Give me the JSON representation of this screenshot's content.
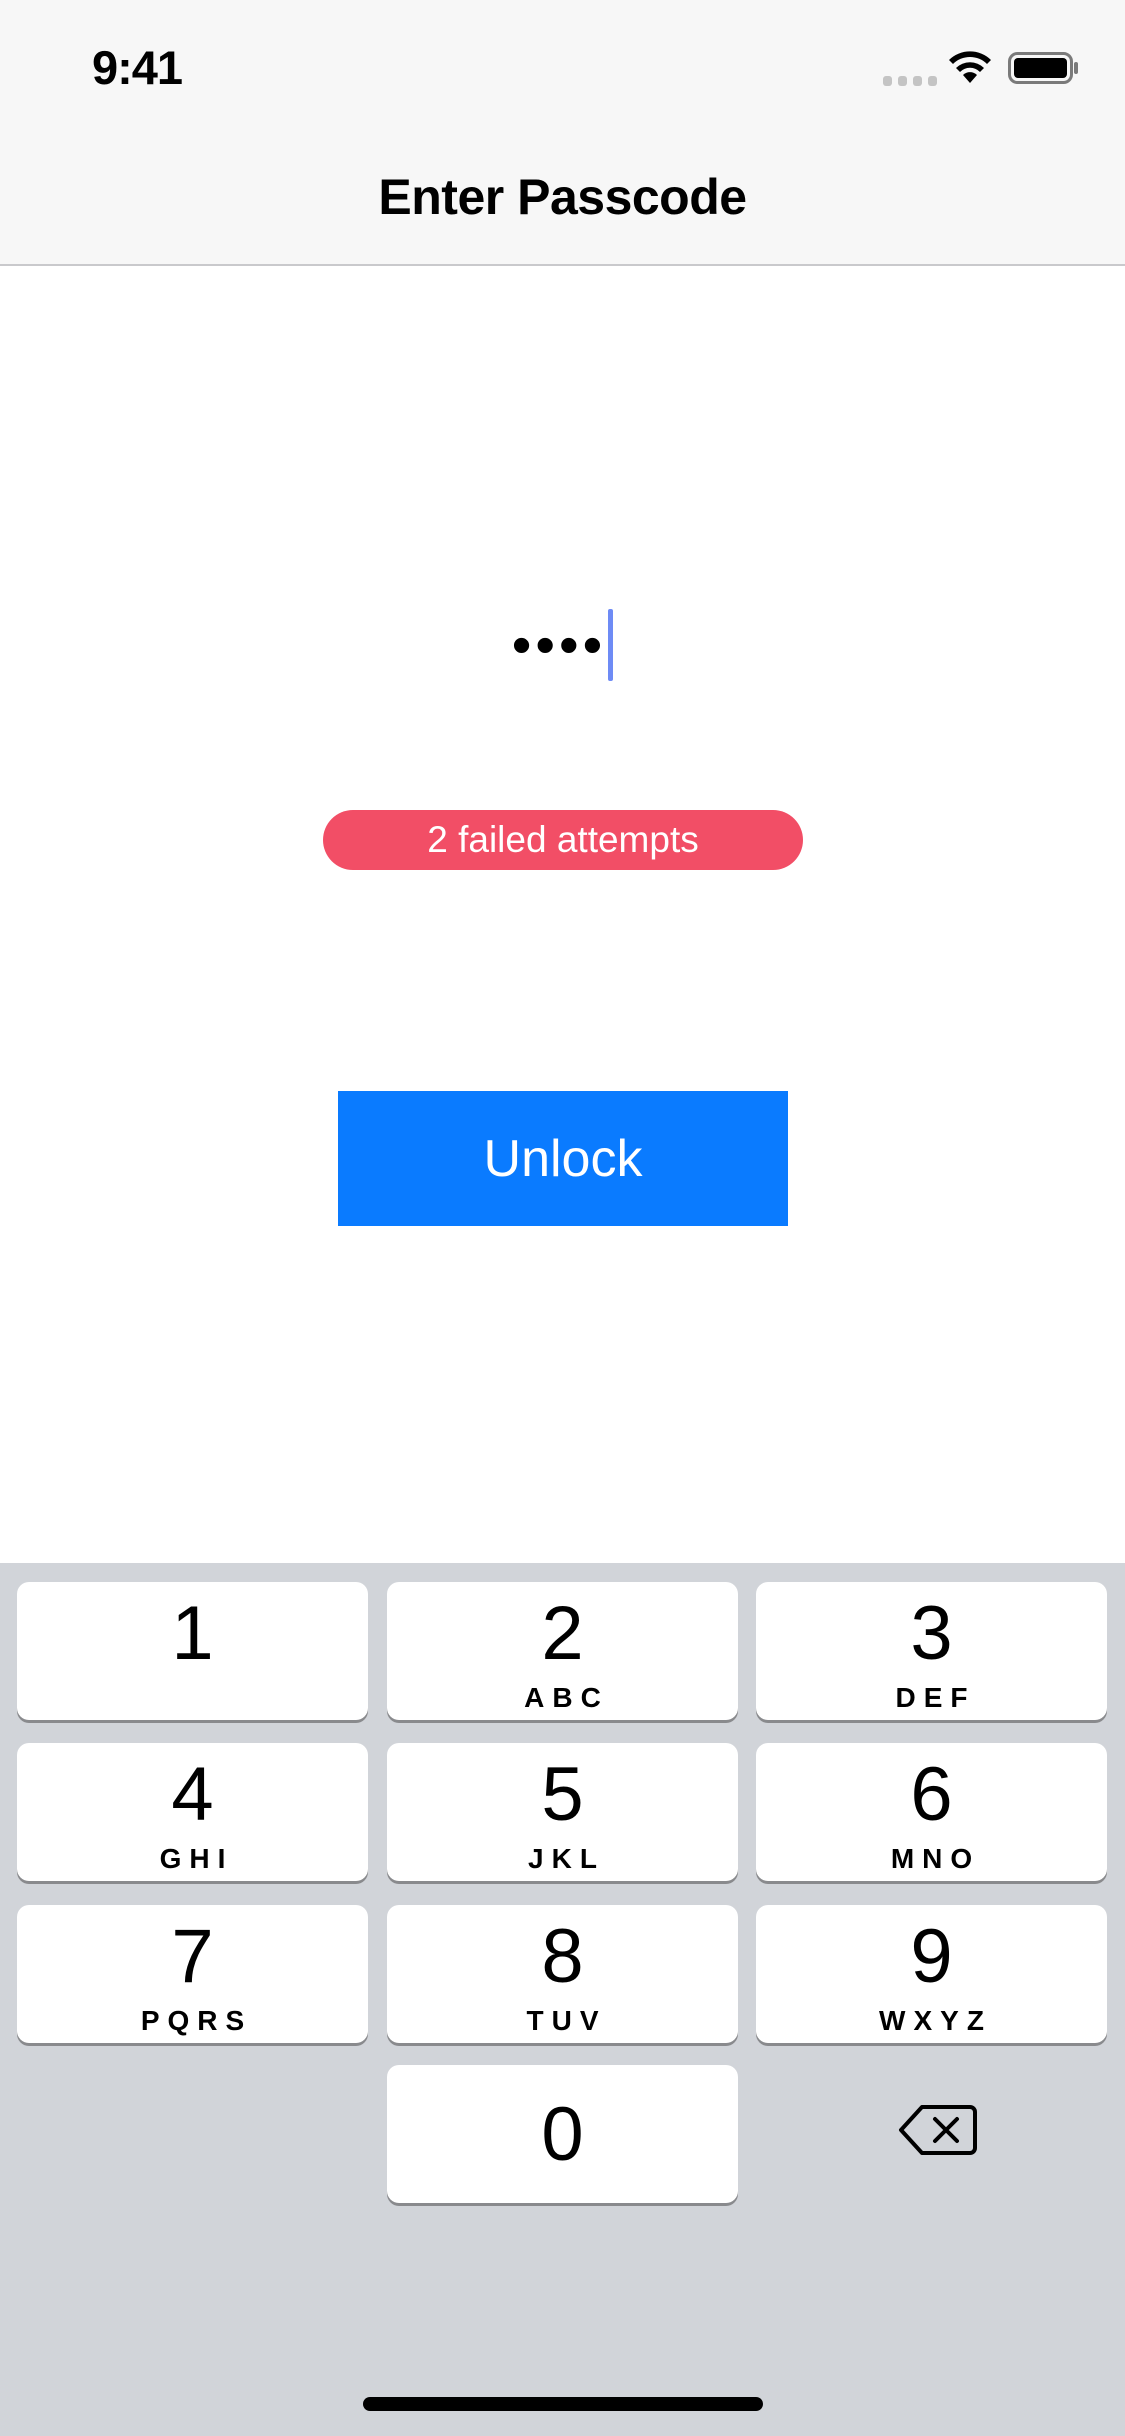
{
  "status_bar": {
    "time": "9:41"
  },
  "nav": {
    "title": "Enter Passcode"
  },
  "passcode": {
    "masked_value": "••••"
  },
  "status_badge": {
    "text": "2 failed attempts",
    "color": "#f24e66"
  },
  "unlock_button": {
    "label": "Unlock",
    "color": "#0a7bff"
  },
  "keypad": {
    "keys": [
      {
        "digit": "1",
        "letters": ""
      },
      {
        "digit": "2",
        "letters": "ABC"
      },
      {
        "digit": "3",
        "letters": "DEF"
      },
      {
        "digit": "4",
        "letters": "GHI"
      },
      {
        "digit": "5",
        "letters": "JKL"
      },
      {
        "digit": "6",
        "letters": "MNO"
      },
      {
        "digit": "7",
        "letters": "PQRS"
      },
      {
        "digit": "8",
        "letters": "TUV"
      },
      {
        "digit": "9",
        "letters": "WXYZ"
      },
      {
        "digit": "0",
        "letters": ""
      }
    ],
    "delete_icon": "delete-backspace-icon"
  }
}
